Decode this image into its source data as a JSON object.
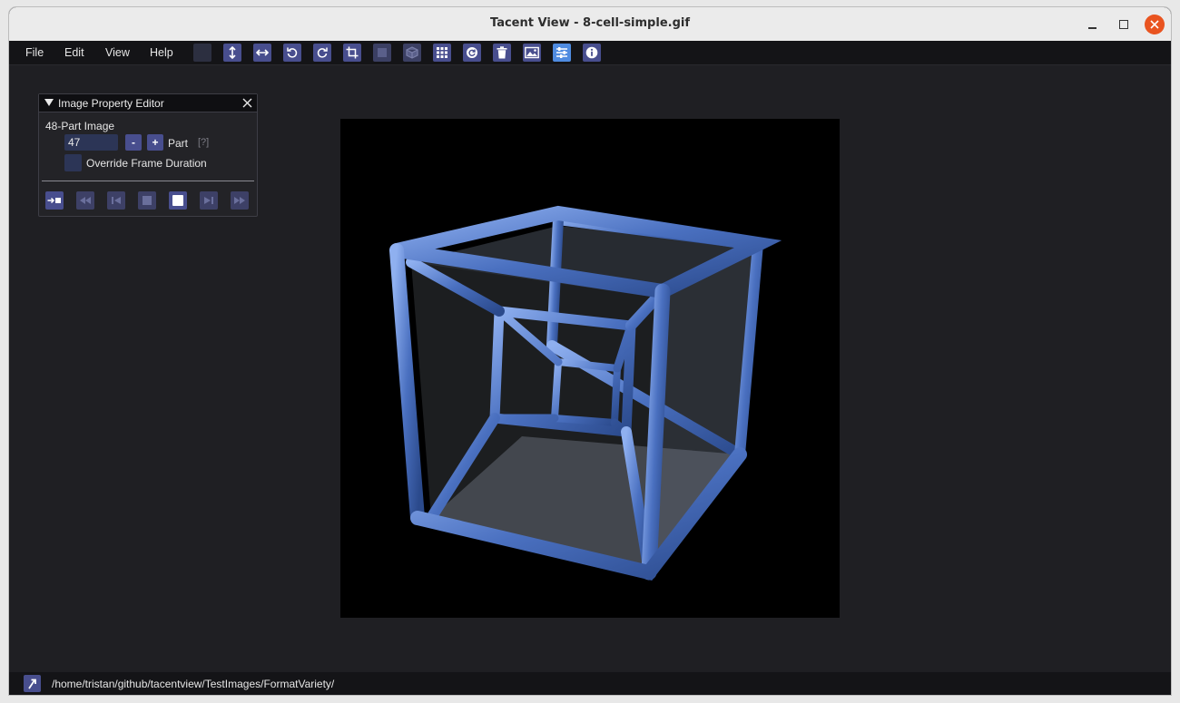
{
  "window": {
    "title": "Tacent View - 8-cell-simple.gif"
  },
  "menu": {
    "items": [
      "File",
      "Edit",
      "View",
      "Help"
    ]
  },
  "toolbar": {
    "buttons": [
      {
        "name": "color-swatch-icon"
      },
      {
        "name": "flip-vertical-icon"
      },
      {
        "name": "flip-horizontal-icon"
      },
      {
        "name": "rotate-ccw-icon"
      },
      {
        "name": "rotate-cw-icon"
      },
      {
        "name": "crop-icon"
      },
      {
        "name": "square-icon"
      },
      {
        "name": "cube-icon"
      },
      {
        "name": "grid-icon"
      },
      {
        "name": "refresh-icon"
      },
      {
        "name": "trash-icon"
      },
      {
        "name": "image-icon"
      },
      {
        "name": "sliders-icon"
      },
      {
        "name": "info-icon"
      }
    ]
  },
  "panel": {
    "title": "Image Property Editor",
    "image_info": "48-Part Image",
    "part_value": "47",
    "minus_label": "-",
    "plus_label": "+",
    "part_label": "Part",
    "help": "[?]",
    "override_label": "Override Frame Duration"
  },
  "status": {
    "path": "/home/tristan/github/tacentview/TestImages/FormatVariety/"
  },
  "colors": {
    "accent": "#484e8e",
    "active": "#4f8be0",
    "close": "#e95420",
    "background": "#1f1f23"
  }
}
